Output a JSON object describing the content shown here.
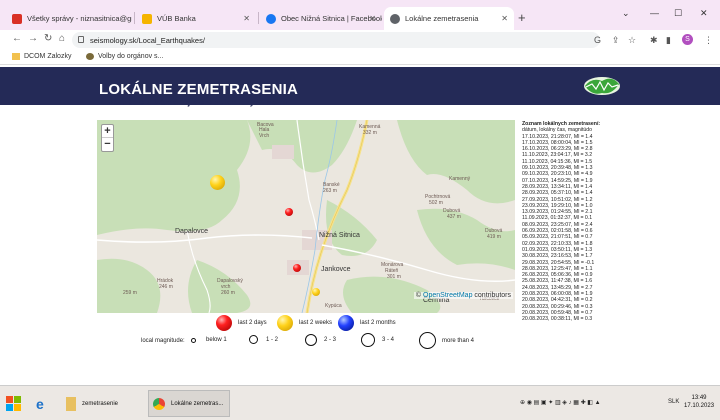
{
  "browser": {
    "tabs": [
      {
        "label": "Všetky správy - niznasitnica@gm",
        "icon_color": "#d93025"
      },
      {
        "label": "VÚB Banka",
        "icon_color": "#f5b400"
      },
      {
        "label": "Obec Nižná Sitnica | Facebook",
        "icon_color": "#1877f2"
      },
      {
        "label": "Lokálne zemetrasenia",
        "icon_color": "#5f6368"
      }
    ],
    "url": "seismology.sk/Local_Earthquakes/",
    "bookmarks": [
      "DCOM Zalozky",
      "Volby do orgánov s..."
    ],
    "avatar_letter": "S"
  },
  "page": {
    "title": "LOKÁLNE ZEMETRASENIA",
    "subtitle": "Lokalizácie z Národnej siete seizmických staníc",
    "map": {
      "zoom_in": "+",
      "zoom_out": "−",
      "attribution_symbol": "©",
      "attribution_link": "OpenStreetMap",
      "attribution_rest": " contributors",
      "labels": [
        {
          "text": "Bacova",
          "class": "maplabel"
        },
        {
          "text": "Hala",
          "class": "maplabel"
        },
        {
          "text": "Vrch",
          "class": "maplabel"
        },
        {
          "text": "Kamenná",
          "class": "maplabel"
        },
        {
          "text": "332 m",
          "class": "maplabel"
        },
        {
          "text": "Banské",
          "class": "maplabel"
        },
        {
          "text": "263 m",
          "class": "maplabel"
        },
        {
          "text": "Kamenný",
          "class": "maplabel"
        },
        {
          "text": "Pochtrnová",
          "class": "maplabel"
        },
        {
          "text": "502 m",
          "class": "maplabel"
        },
        {
          "text": "Dubová",
          "class": "maplabel"
        },
        {
          "text": "437 m",
          "class": "maplabel"
        },
        {
          "text": "Dubová",
          "class": "maplabel"
        },
        {
          "text": "419 m",
          "class": "maplabel"
        },
        {
          "text": "Dapalovce",
          "class": "maplabel town"
        },
        {
          "text": "Nižná Sitnica",
          "class": "maplabel town"
        },
        {
          "text": "Jankovce",
          "class": "maplabel town"
        },
        {
          "text": "Hrádok",
          "class": "maplabel"
        },
        {
          "text": "246 m",
          "class": "maplabel"
        },
        {
          "text": "Dapalovský",
          "class": "maplabel"
        },
        {
          "text": "vrch",
          "class": "maplabel"
        },
        {
          "text": "260 m",
          "class": "maplabel"
        },
        {
          "text": "Kypúca",
          "class": "maplabel"
        },
        {
          "text": "Čermina",
          "class": "maplabel town"
        },
        {
          "text": "Turcovce",
          "class": "maplabel"
        },
        {
          "text": "Monárova",
          "class": "maplabel"
        },
        {
          "text": "Ráteň",
          "class": "maplabel"
        },
        {
          "text": "301 m",
          "class": "maplabel"
        },
        {
          "text": "259 m",
          "class": "maplabel"
        }
      ],
      "markers": [
        {
          "color": "yellow",
          "size": 15
        },
        {
          "color": "red",
          "size": 8
        },
        {
          "color": "red",
          "size": 8
        },
        {
          "color": "yellow",
          "size": 8
        }
      ]
    },
    "list": {
      "title": "Zoznam lokálnych zemetrasení:",
      "columns": "dátum, lokálny čas, magnitúdo",
      "entries": [
        "17.10.2023, 21:28:07, Ml = 1.4",
        "17.10.2023, 08:00:04, Ml = 1.5",
        "16.10.2023, 06:23:29, Ml = 2.8",
        "11.10.2023, 23:04:17, Ml = 3.2",
        "11.10.2023, 04:15:36, Ml = 1.5",
        "09.10.2023, 20:39:48, Ml = 1.3",
        "09.10.2023, 20:23:10, Ml = 4.9",
        "07.10.2023, 14:59:25, Ml = 1.9",
        "28.09.2023, 13:34:11, Ml = 1.4",
        "28.09.2023, 05:37:10, Ml = 1.4",
        "27.09.2023, 10:51:02, Ml = 1.2",
        "23.09.2023, 19:29:10, Ml = 1.0",
        "13.09.2023, 01:24:55, Ml = 2.1",
        "11.09.2023, 01:32:37, Ml = 0.1",
        "08.09.2023, 23:25:07, Ml = 2.4",
        "06.09.2023, 02:01:58, Ml = 0.6",
        "05.09.2023, 21:07:51, Ml = 0.7",
        "02.09.2023, 22:10:33, Ml = 1.8",
        "01.09.2023, 03:50:11, Ml = 1.3",
        "30.08.2023, 23:16:53, Ml = 1.7",
        "29.08.2023, 20:54:55, Ml = -0.1",
        "28.08.2023, 12:25:47, Ml = 1.1",
        "26.08.2023, 05:06:36, Ml = 0.9",
        "25.08.2023, 11:47:38, Ml = 1.6",
        "24.08.2023, 13:45:29, Ml = 2.7",
        "20.08.2023, 06:00:08, Ml = 1.9",
        "20.08.2023, 04:42:31, Ml = 0.2",
        "20.08.2023, 00:29:46, Ml = 0.3",
        "20.08.2023, 00:59:48, Ml = 0.7",
        "20.08.2023, 00:38:11, Ml = 0.3"
      ]
    },
    "legend": {
      "age": [
        {
          "label": "last 2 days",
          "color": "red"
        },
        {
          "label": "last 2 weeks",
          "color": "yellow"
        },
        {
          "label": "last 2 months",
          "color": "blue"
        }
      ],
      "magnitude_title": "local magnitude:",
      "magnitude": [
        {
          "label": "below 1",
          "size": 5
        },
        {
          "label": "1 - 2",
          "size": 9
        },
        {
          "label": "2 - 3",
          "size": 12
        },
        {
          "label": "3 - 4",
          "size": 14
        },
        {
          "label": "more than 4",
          "size": 17
        }
      ]
    }
  },
  "taskbar": {
    "items": [
      "zemetrasenie",
      "Lokálne zemetras..."
    ],
    "lang": "SLK",
    "time": "13:49",
    "date": "17.10.2023"
  }
}
